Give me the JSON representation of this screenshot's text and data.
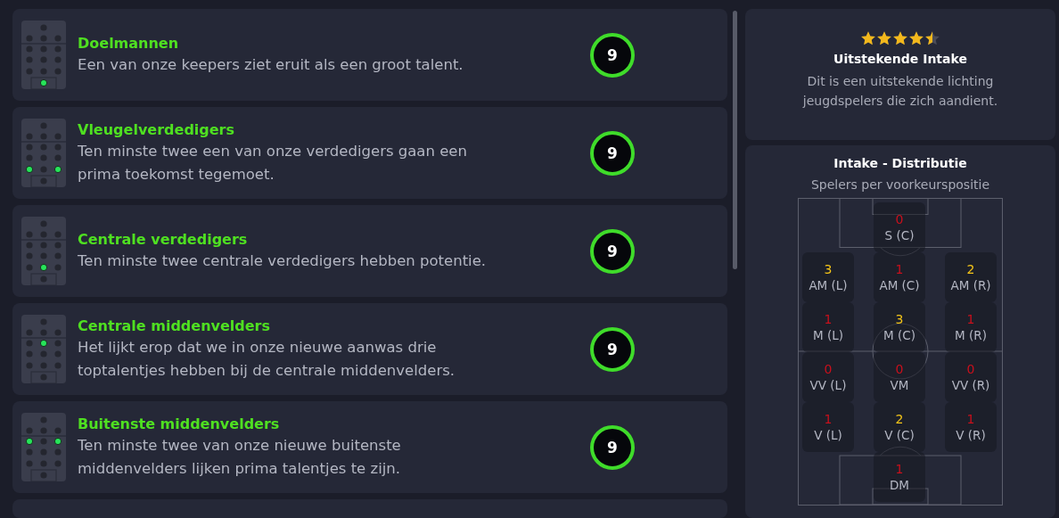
{
  "reports": [
    {
      "title": "Doelmannen",
      "text": "Een van onze keepers ziet eruit als een groot talent.",
      "score": "9",
      "dots": [
        {
          "on": false
        },
        {
          "on": false
        },
        {
          "on": false
        },
        {
          "on": false
        },
        {
          "on": false
        },
        {
          "on": false
        },
        {
          "on": false
        },
        {
          "on": false
        },
        {
          "on": false
        },
        {
          "on": false
        },
        {
          "on": false
        },
        {
          "on": false
        },
        {
          "on": false
        },
        {
          "on": true
        }
      ]
    },
    {
      "title": "Vleugelverdedigers",
      "text": "Ten minste twee een van onze verdedigers gaan een prima toekomst tegemoet.",
      "score": "9",
      "dots": [
        {
          "on": false
        },
        {
          "on": false
        },
        {
          "on": false
        },
        {
          "on": false
        },
        {
          "on": false
        },
        {
          "on": false
        },
        {
          "on": false
        },
        {
          "on": false
        },
        {
          "on": false
        },
        {
          "on": false
        },
        {
          "on": true
        },
        {
          "on": false
        },
        {
          "on": true
        },
        {
          "on": false
        }
      ]
    },
    {
      "title": "Centrale verdedigers",
      "text": "Ten minste twee centrale verdedigers hebben potentie.",
      "score": "9",
      "dots": [
        {
          "on": false
        },
        {
          "on": false
        },
        {
          "on": false
        },
        {
          "on": false
        },
        {
          "on": false
        },
        {
          "on": false
        },
        {
          "on": false
        },
        {
          "on": false
        },
        {
          "on": false
        },
        {
          "on": false
        },
        {
          "on": false
        },
        {
          "on": true
        },
        {
          "on": false
        },
        {
          "on": false
        }
      ]
    },
    {
      "title": "Centrale middenvelders",
      "text": "Het lijkt erop dat we in onze nieuwe aanwas drie toptalentjes hebben bij de centrale middenvelders.",
      "score": "9",
      "dots": [
        {
          "on": false
        },
        {
          "on": false
        },
        {
          "on": false
        },
        {
          "on": false
        },
        {
          "on": false
        },
        {
          "on": true
        },
        {
          "on": false
        },
        {
          "on": false
        },
        {
          "on": false
        },
        {
          "on": false
        },
        {
          "on": false
        },
        {
          "on": false
        },
        {
          "on": false
        },
        {
          "on": false
        }
      ]
    },
    {
      "title": "Buitenste middenvelders",
      "text": "Ten minste twee van onze nieuwe buitenste middenvelders lijken prima talentjes te zijn.",
      "score": "9",
      "dots": [
        {
          "on": false
        },
        {
          "on": false
        },
        {
          "on": false
        },
        {
          "on": false
        },
        {
          "on": true
        },
        {
          "on": false
        },
        {
          "on": true
        },
        {
          "on": false
        },
        {
          "on": false
        },
        {
          "on": false
        },
        {
          "on": false
        },
        {
          "on": false
        },
        {
          "on": false
        },
        {
          "on": false
        }
      ]
    }
  ],
  "summary": {
    "stars": 4.5,
    "title": "Uitstekende Intake",
    "text": "Dit is een uitstekende lichting jeugdspelers die zich aandient."
  },
  "distribution": {
    "title": "Intake - Distributie",
    "subtitle": "Spelers per voorkeurspositie",
    "rows": [
      {
        "kind": "single",
        "positions": [
          {
            "count": "0",
            "label": "S (C)",
            "color": "#c8101c"
          }
        ]
      },
      {
        "kind": "triple",
        "positions": [
          {
            "count": "3",
            "label": "AM (L)",
            "color": "#f5c518"
          },
          {
            "count": "1",
            "label": "AM (C)",
            "color": "#c8101c"
          },
          {
            "count": "2",
            "label": "AM (R)",
            "color": "#f5c518"
          }
        ]
      },
      {
        "kind": "triple",
        "positions": [
          {
            "count": "1",
            "label": "M (L)",
            "color": "#c8101c"
          },
          {
            "count": "3",
            "label": "M (C)",
            "color": "#f5c518"
          },
          {
            "count": "1",
            "label": "M (R)",
            "color": "#c8101c"
          }
        ]
      },
      {
        "kind": "triple",
        "positions": [
          {
            "count": "0",
            "label": "VV (L)",
            "color": "#c8101c"
          },
          {
            "count": "0",
            "label": "VM",
            "color": "#c8101c"
          },
          {
            "count": "0",
            "label": "VV (R)",
            "color": "#c8101c"
          }
        ]
      },
      {
        "kind": "triple",
        "positions": [
          {
            "count": "1",
            "label": "V (L)",
            "color": "#c8101c"
          },
          {
            "count": "2",
            "label": "V (C)",
            "color": "#f5c518"
          },
          {
            "count": "1",
            "label": "V (R)",
            "color": "#c8101c"
          }
        ]
      },
      {
        "kind": "single",
        "positions": [
          {
            "count": "1",
            "label": "DM",
            "color": "#c8101c"
          }
        ]
      }
    ]
  }
}
